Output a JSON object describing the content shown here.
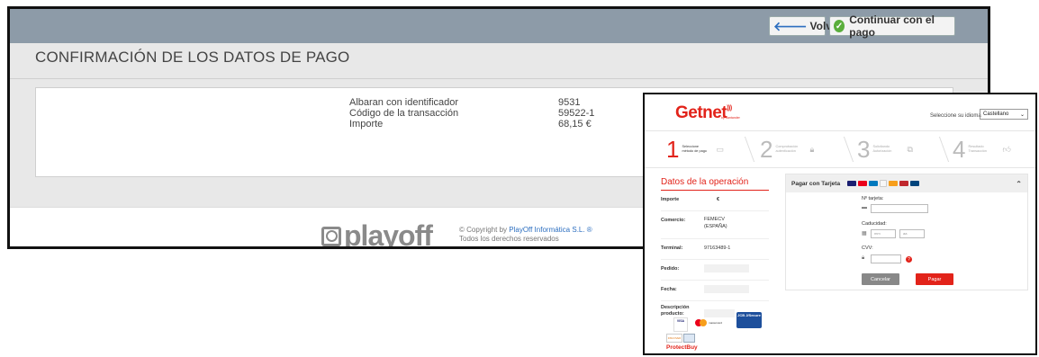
{
  "playoff": {
    "buttons": {
      "back": "Volver",
      "continue": "Continuar con el pago"
    },
    "title": "CONFIRMACIÓN DE LOS DATOS DE PAGO",
    "details": [
      {
        "label": "Albaran con identificador",
        "value": "9531"
      },
      {
        "label": "Código de la transacción",
        "value": "59522-1"
      },
      {
        "label": "Importe",
        "value": "68,15 €"
      }
    ],
    "logo_text": "playoff",
    "copyright_prefix": "© Copyright by ",
    "copyright_company": "PlayOff Informática S.L. ®",
    "rights": "Todos los derechos reservados"
  },
  "getnet": {
    "brand": "Getnet",
    "brand_sub": "by Santander",
    "language_label": "Seleccione su idioma",
    "language_value": "Castellano",
    "steps": [
      {
        "num": "1",
        "text": "Seleccione método de pago"
      },
      {
        "num": "2",
        "text": "Comprobación autenticación"
      },
      {
        "num": "3",
        "text": "Solicitando Autorización"
      },
      {
        "num": "4",
        "text": "Resultado Transacción"
      }
    ],
    "side_title": "Datos de la operación",
    "side_rows": [
      {
        "key": "Importe",
        "value": "€"
      },
      {
        "key": "Comercio:",
        "value": "FEMECV (ESPAÑA)"
      },
      {
        "key": "Terminal:",
        "value": "97163489-1"
      },
      {
        "key": "Pedido:",
        "value": ""
      },
      {
        "key": "Fecha:",
        "value": ""
      },
      {
        "key": "Descripción producto:",
        "value": ""
      }
    ],
    "card_logos": [
      "VISA",
      "mastercard",
      "JCB J/Secure",
      "DISCOVER",
      "ProtectBuy"
    ],
    "panel_title": "Pagar con Tarjeta",
    "form": {
      "card_label": "Nº tarjeta:",
      "expiry_label": "Caducidad:",
      "month_placeholder": "mm",
      "year_placeholder": "aa",
      "cvv_label": "CVV:",
      "cancel": "Cancelar",
      "pay": "Pagar"
    }
  }
}
